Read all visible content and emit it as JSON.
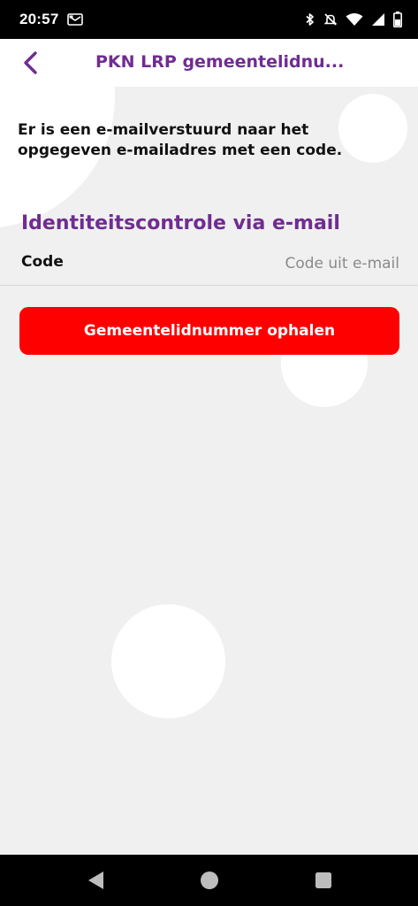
{
  "status_bar": {
    "time": "20:57",
    "icons": [
      "notification-icon",
      "bluetooth-icon",
      "mute-icon",
      "wifi-icon",
      "signal-icon",
      "battery-icon"
    ]
  },
  "app_bar": {
    "title": "PKN LRP gemeentelidnu..."
  },
  "main": {
    "info_text": "Er is een e-mailverstuurd naar het opgegeven e-mailadres met een code.",
    "section_title": "Identiteitscontrole via e-mail",
    "code_label": "Code",
    "code_placeholder": "Code uit e-mail",
    "code_value": "",
    "submit_label": "Gemeentelidnummer ophalen"
  },
  "nav_bar": {
    "icons": [
      "nav-back-icon",
      "nav-home-icon",
      "nav-recents-icon"
    ]
  },
  "colors": {
    "accent_purple": "#6f2d91",
    "button_red": "#ff0000",
    "background": "#f0f0f0"
  }
}
